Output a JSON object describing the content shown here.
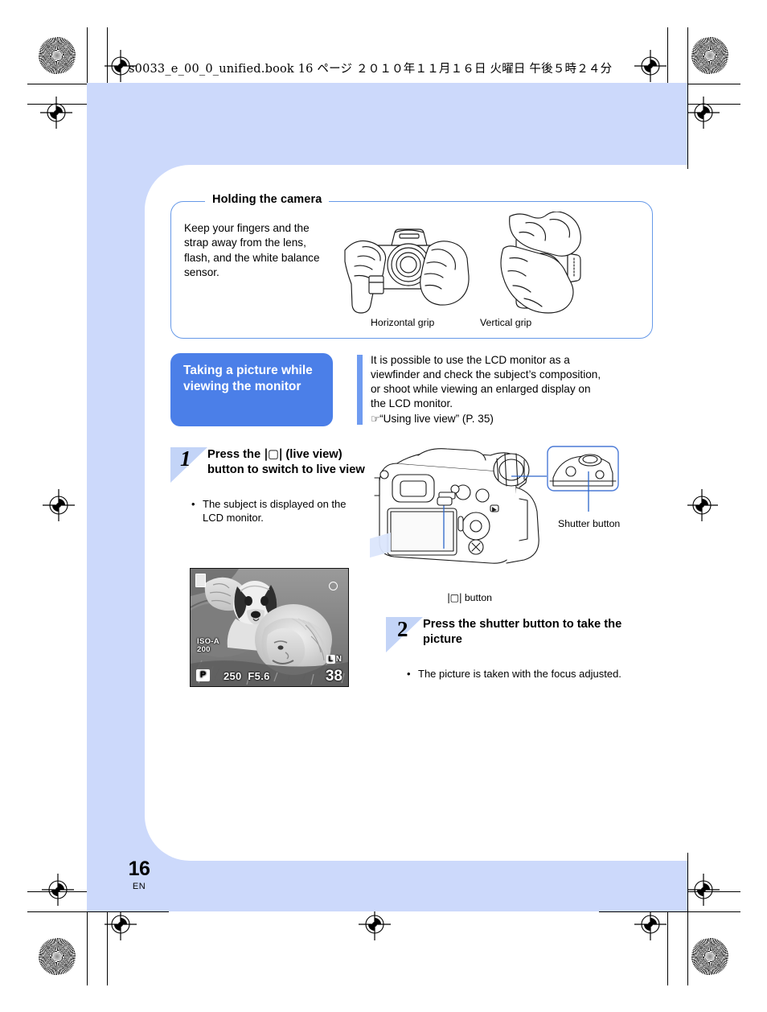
{
  "print": {
    "slugline": "s0033_e_00_0_unified.book   16 ページ   ２０１０年１１月１６日   火曜日   午後５時２４分"
  },
  "folio": {
    "page_number": "16",
    "language": "EN"
  },
  "colors": {
    "page_background": "#ccd9fb",
    "accent_blue": "#4b7fe8",
    "rule_blue": "#6f9bf0",
    "box_border": "#6699e8",
    "step_wedge": "#c3d4f7"
  },
  "holding_box": {
    "legend": "Holding the camera",
    "body": "Keep your fingers and the strap away from the lens, flash, and the white balance sensor.",
    "captions": {
      "horizontal": "Horizontal grip",
      "vertical": "Vertical grip"
    }
  },
  "section": {
    "title": "Taking a picture while viewing the monitor",
    "body_lines": [
      "It is possible to use the LCD monitor as a",
      "viewfinder and check the subject’s composition,",
      "or shoot while viewing an enlarged display on",
      "the LCD monitor."
    ],
    "reference_icon": "pointing-hand-icon",
    "reference": "“Using live view” (P. 35)"
  },
  "steps": [
    {
      "number": "1",
      "heading_parts": [
        "Press the ",
        "|▢|",
        " (live view) button to switch to live view"
      ],
      "heading_plain": "Press the |O| (live view) button to switch to live view",
      "bullet": "The subject is displayed on the LCD monitor."
    },
    {
      "number": "2",
      "heading_plain": "Press the shutter button to take the picture",
      "bullet": "The picture is taken with the focus adjusted."
    }
  ],
  "camera_callouts": {
    "shutter_button": "Shutter button",
    "live_view_button_icon": "|▢|",
    "live_view_button": "button"
  },
  "lcd_monitor": {
    "battery_icon": "battery-icon",
    "iso_label": "ISO-A",
    "iso_value": "200",
    "mode": "P",
    "shutter_speed": "250",
    "aperture": "F5.6",
    "shots_remaining": "38",
    "quality_badge": "L",
    "quality_suffix": "N"
  }
}
